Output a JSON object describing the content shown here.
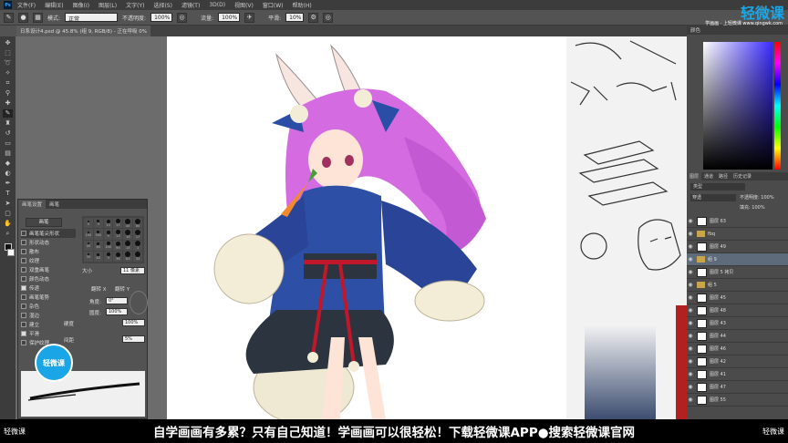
{
  "menu": {
    "items": [
      "文件(F)",
      "编辑(E)",
      "图像(I)",
      "图层(L)",
      "文字(Y)",
      "选择(S)",
      "滤镜(T)",
      "3D(D)",
      "视图(V)",
      "窗口(W)",
      "帮助(H)"
    ]
  },
  "options": {
    "mode_label": "模式:",
    "mode_value": "正常",
    "opacity_label": "不透明度:",
    "opacity_value": "100%",
    "flow_label": "流量:",
    "flow_value": "100%",
    "smooth_label": "平滑:",
    "smooth_value": "10%"
  },
  "document": {
    "tab_title": "日系设计4.psd @ 45.8% (组 9, RGB/8) - 正在呼吸 0%"
  },
  "brush_panel": {
    "tabs": [
      "画笔设置",
      "画笔"
    ],
    "presets_button": "画笔",
    "rows": [
      {
        "label": "画笔笔尖形状",
        "checked": false,
        "selected": true
      },
      {
        "label": "形状动态",
        "checked": false,
        "selected": false
      },
      {
        "label": "散布",
        "checked": false,
        "selected": false
      },
      {
        "label": "纹理",
        "checked": false,
        "selected": false
      },
      {
        "label": "双重画笔",
        "checked": false,
        "selected": false
      },
      {
        "label": "颜色动态",
        "checked": false,
        "selected": false
      },
      {
        "label": "传递",
        "checked": true,
        "selected": false
      },
      {
        "label": "画笔笔势",
        "checked": false,
        "selected": false
      },
      {
        "label": "杂色",
        "checked": false,
        "selected": false
      },
      {
        "label": "湿边",
        "checked": false,
        "selected": false
      },
      {
        "label": "建立",
        "checked": false,
        "selected": false
      },
      {
        "label": "平滑",
        "checked": true,
        "selected": false
      },
      {
        "label": "保护纹理",
        "checked": false,
        "selected": false
      }
    ],
    "tip_sizes": [
      "5",
      "9",
      "13",
      "17",
      "45",
      "65",
      "100",
      "300",
      "9",
      "13",
      "19",
      "17",
      "45",
      "65",
      "100",
      "95",
      "13",
      "1",
      "35",
      "63",
      "3",
      "36",
      "63",
      "33"
    ],
    "size_label": "大小",
    "size_value": "11 像素",
    "flip_x": "翻转 X",
    "flip_y": "翻转 Y",
    "angle_label": "角度:",
    "angle_value": "0°",
    "roundness_label": "圆度:",
    "roundness_value": "100%",
    "hardness_label": "硬度",
    "hardness_value": "100%",
    "spacing_label": "间距",
    "spacing_value": "5%"
  },
  "panels": {
    "color_title": "颜色",
    "layer_tabs": [
      "图层",
      "通道",
      "路径",
      "历史记录"
    ],
    "filter_label": "类型",
    "blend_mode": "穿透",
    "opacity_label": "不透明度:",
    "opacity_value": "100%",
    "fill_label": "填充:",
    "fill_value": "100%",
    "layers": [
      {
        "name": "图层 63",
        "type": "layer"
      },
      {
        "name": "fbq",
        "type": "folder"
      },
      {
        "name": "图层 49",
        "type": "layer"
      },
      {
        "name": "组 9",
        "type": "folder",
        "selected": true
      },
      {
        "name": "图层 5 拷贝",
        "type": "layer"
      },
      {
        "name": "组 5",
        "type": "folder"
      },
      {
        "name": "图层 45",
        "type": "layer"
      },
      {
        "name": "图层 48",
        "type": "layer"
      },
      {
        "name": "图层 43",
        "type": "layer"
      },
      {
        "name": "图层 44",
        "type": "layer"
      },
      {
        "name": "图层 46",
        "type": "layer"
      },
      {
        "name": "图层 42",
        "type": "layer"
      },
      {
        "name": "图层 41",
        "type": "layer"
      },
      {
        "name": "图层 47",
        "type": "layer"
      },
      {
        "name": "图层 55",
        "type": "layer"
      }
    ]
  },
  "banner": {
    "left_logo": "轻微课",
    "text": "自学画画有多累？只有自己知道！学画画可以很轻松！下载轻微课APP●搜索轻微课官网",
    "right_logo": "轻微课"
  },
  "watermark": {
    "title": "轻微课",
    "subtitle": "学画画 · 上轻微课 www.qingwk.com"
  },
  "badge": {
    "label": "轻微课"
  },
  "colors": {
    "accent": "#19a5e6",
    "panel_bg": "#535353",
    "dark_bg": "#3c3c3c",
    "hair": "#d46be0",
    "coat": "#2e4fa6",
    "ribbon": "#c0172a",
    "fur": "#f3edd8"
  }
}
